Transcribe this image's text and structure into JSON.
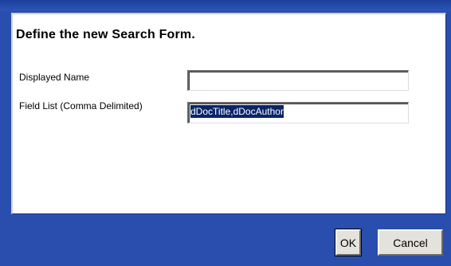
{
  "dialog": {
    "heading": "Define the new Search Form."
  },
  "form": {
    "displayed_name": {
      "label": "Displayed Name",
      "value": ""
    },
    "field_list": {
      "label": "Field List (Comma Delimited)",
      "value": "dDocTitle,dDocAuthor"
    }
  },
  "buttons": {
    "ok": "OK",
    "cancel": "Cancel"
  },
  "colors": {
    "dialog_frame": "#2a4eae",
    "selection": "#0a246a"
  }
}
